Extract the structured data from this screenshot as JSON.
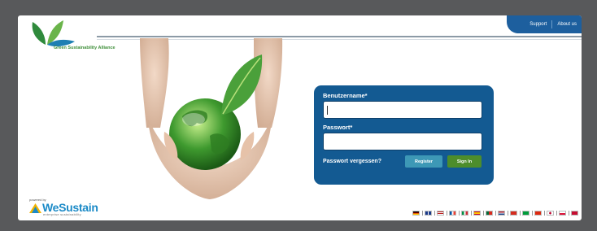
{
  "brand": {
    "name": "Green Sustainability Alliance"
  },
  "nav": {
    "support": "Support",
    "about": "About us"
  },
  "login": {
    "username_label": "Benutzername*",
    "password_label": "Passwort*",
    "username_value": "",
    "password_value": "",
    "forgot": "Passwort vergessen?",
    "register": "Register",
    "signin": "Sign In"
  },
  "powered": {
    "small": "powered by",
    "name": "WeSustain",
    "tagline": "enterprise sustainability"
  },
  "colors": {
    "accent": "#135a92",
    "frame": "#58595b",
    "register": "#3d98b6",
    "signin": "#4d8d2b"
  },
  "flags": [
    "de-flag",
    "uk-flag",
    "us-flag",
    "fr-flag",
    "it-flag",
    "es-flag",
    "pt-flag",
    "nl-flag",
    "ch-flag",
    "br-flag",
    "cn-flag",
    "jp-flag",
    "pl-flag",
    "dk-flag"
  ]
}
